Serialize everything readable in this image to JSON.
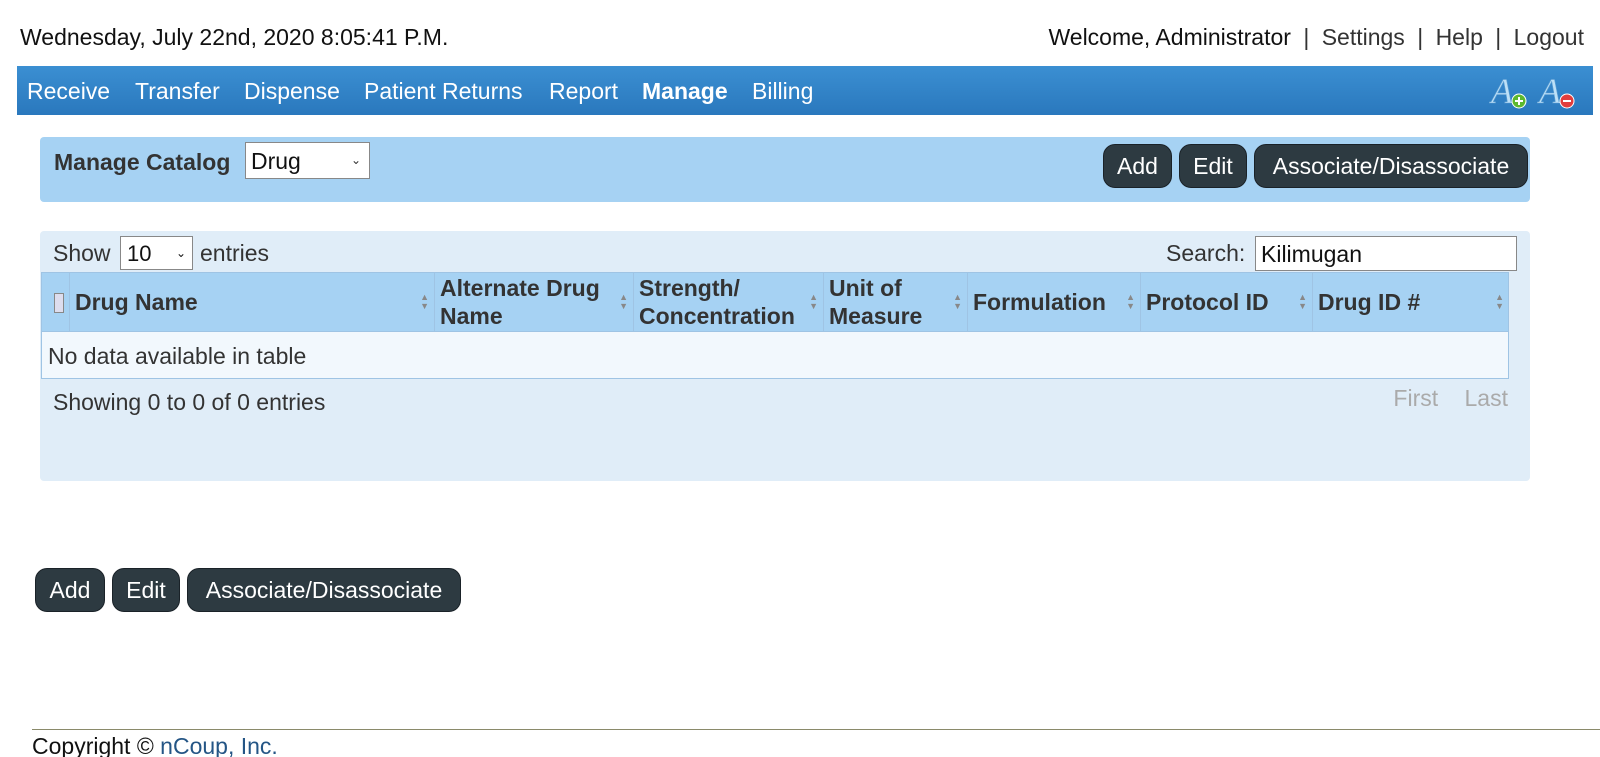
{
  "header": {
    "datetime": "Wednesday, July 22nd, 2020 8:05:41 P.M.",
    "welcome": "Welcome, Administrator",
    "links": [
      "Settings",
      "Help",
      "Logout"
    ],
    "separator": "|"
  },
  "nav": {
    "items": [
      "Receive",
      "Transfer",
      "Dispense",
      "Patient Returns",
      "Report",
      "Manage",
      "Billing"
    ],
    "active": "Manage",
    "font_increase_icon": "font-increase-icon",
    "font_decrease_icon": "font-decrease-icon"
  },
  "catalog": {
    "label": "Manage Catalog",
    "selected": "Drug",
    "buttons": [
      "Add",
      "Edit",
      "Associate/Disassociate"
    ]
  },
  "table": {
    "show_label": "Show",
    "page_size": "10",
    "entries_label": "entries",
    "search_label": "Search:",
    "search_value": "Kilimugan",
    "columns": [
      "Drug Name",
      "Alternate Drug Name",
      "Strength/ Concentration",
      "Unit of Measure",
      "Formulation",
      "Protocol ID",
      "Drug ID #"
    ],
    "empty_message": "No data available in table",
    "info": "Showing 0 to 0 of 0 entries",
    "pager": [
      "First",
      "Last"
    ]
  },
  "bottom_buttons": [
    "Add",
    "Edit",
    "Associate/Disassociate"
  ],
  "footer": {
    "copyright": "Copyright ©",
    "company": "nCoup, Inc."
  },
  "colors": {
    "nav_blue": "#2a78bd",
    "panel_blue": "#a6d2f3",
    "table_panel": "#e0edf8",
    "button_dark": "#2d3a41"
  }
}
